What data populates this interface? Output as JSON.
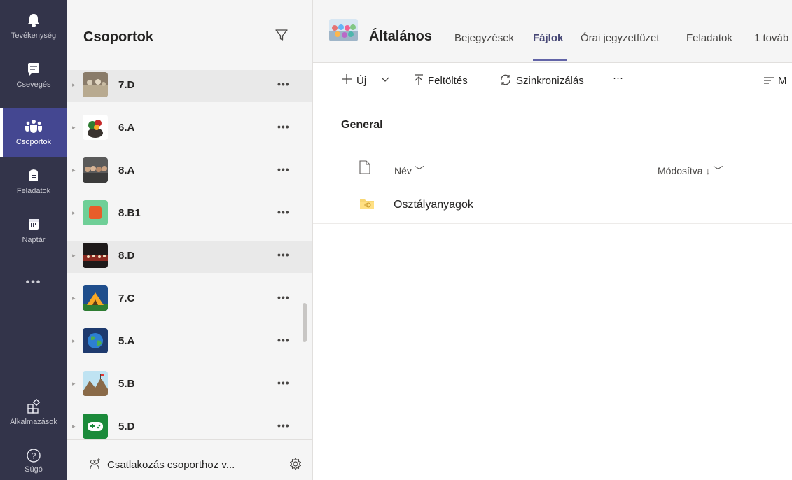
{
  "rail": {
    "items": [
      {
        "label": "Tevékenység",
        "icon": "bell-icon"
      },
      {
        "label": "Csevegés",
        "icon": "chat-icon"
      },
      {
        "label": "Csoportok",
        "icon": "teams-icon",
        "active": true
      },
      {
        "label": "Feladatok",
        "icon": "assignments-icon"
      },
      {
        "label": "Naptár",
        "icon": "calendar-icon"
      }
    ],
    "more": "•••",
    "apps_label": "Alkalmazások",
    "help_label": "Súgó"
  },
  "panel": {
    "title": "Csoportok",
    "teams": [
      {
        "name": "7.D",
        "more": "•••"
      },
      {
        "name": "6.A",
        "more": "•••"
      },
      {
        "name": "8.A",
        "more": "•••"
      },
      {
        "name": "8.B1",
        "more": "•••"
      },
      {
        "name": "8.D",
        "more": "•••"
      },
      {
        "name": "7.C",
        "more": "•••"
      },
      {
        "name": "5.A",
        "more": "•••"
      },
      {
        "name": "5.B",
        "more": "•••"
      },
      {
        "name": "5.D",
        "more": "•••"
      }
    ],
    "join_label": "Csatlakozás csoporthoz v..."
  },
  "main": {
    "channel": "Általános",
    "tabs": [
      "Bejegyzések",
      "Fájlok",
      "Órai jegyzetfüzet",
      "Feladatok",
      "1 továb"
    ],
    "toolbar": {
      "new": "Új",
      "upload": "Feltöltés",
      "sync": "Szinkronizálás",
      "more": "···",
      "view": "M"
    },
    "section": "General",
    "columns": {
      "name": "Név",
      "modified": "Módosítva ↓"
    },
    "files": [
      {
        "name": "Osztályanyagok"
      }
    ]
  },
  "colors": {
    "rail_bg": "#33344a",
    "rail_active": "#444791",
    "accent": "#6264a7",
    "panel_bg": "#f5f5f5"
  }
}
